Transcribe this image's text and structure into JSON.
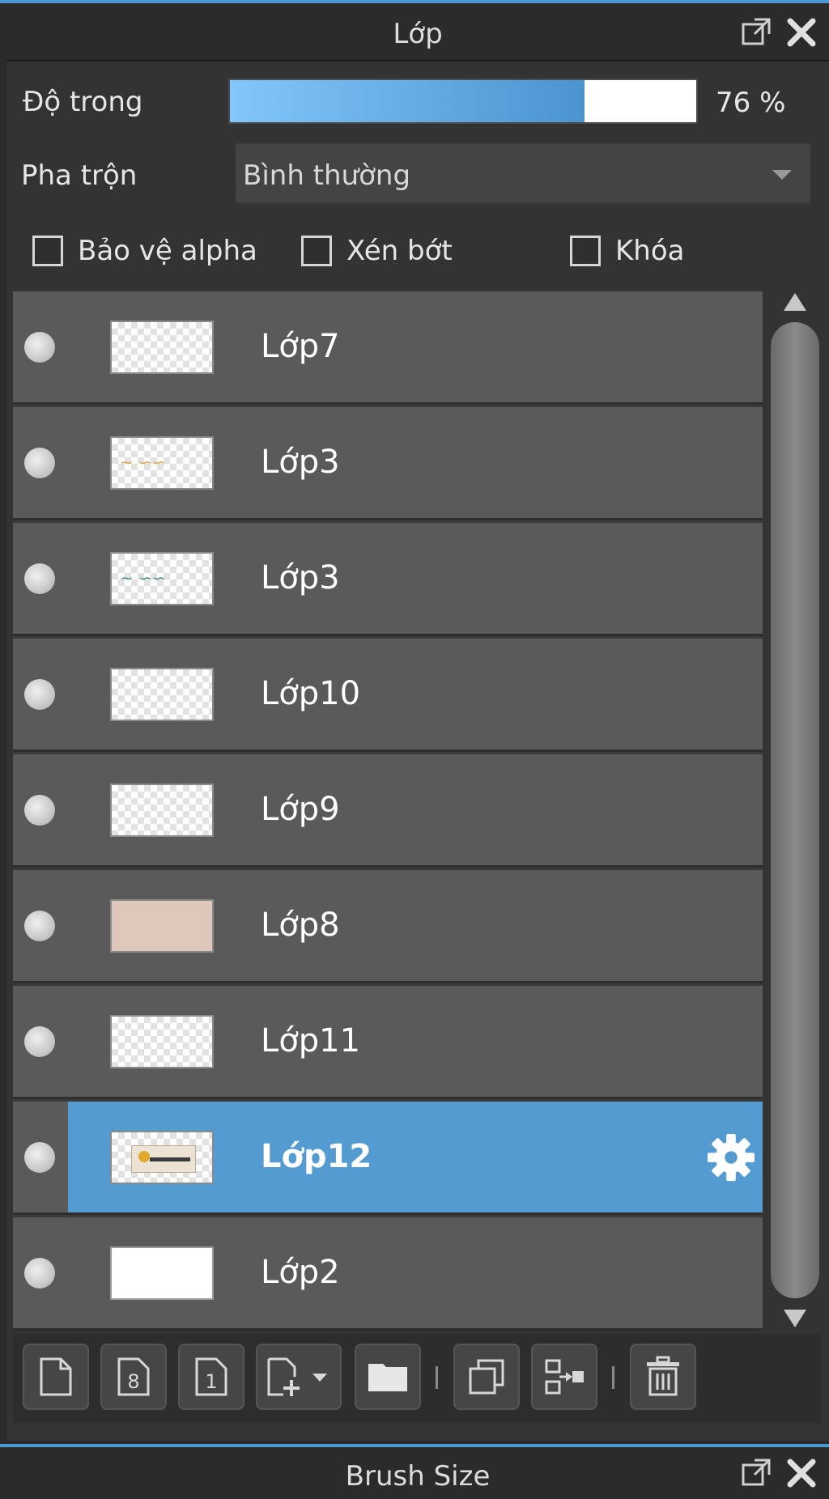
{
  "panel": {
    "title": "Lớp",
    "undock_icon": "undock-icon",
    "close_icon": "close-icon"
  },
  "opacity": {
    "label": "Độ trong",
    "value_text": "76 %",
    "value_percent": 76
  },
  "blend": {
    "label": "Pha trộn",
    "selected": "Bình thường"
  },
  "options": {
    "protect_alpha": {
      "label": "Bảo vệ alpha",
      "checked": false
    },
    "clipping": {
      "label": "Xén bớt",
      "checked": false
    },
    "lock": {
      "label": "Khóa",
      "checked": false
    }
  },
  "layers": [
    {
      "name": "Lớp7",
      "thumb": "transparent"
    },
    {
      "name": "Lớp3",
      "thumb": "transparent-orange-text"
    },
    {
      "name": "Lớp3",
      "thumb": "transparent-teal-text"
    },
    {
      "name": "Lớp10",
      "thumb": "transparent"
    },
    {
      "name": "Lớp9",
      "thumb": "transparent"
    },
    {
      "name": "Lớp8",
      "thumb": "beige"
    },
    {
      "name": "Lớp11",
      "thumb": "transparent"
    },
    {
      "name": "Lớp12",
      "thumb": "scene",
      "selected": true
    },
    {
      "name": "Lớp2",
      "thumb": "white"
    }
  ],
  "toolbar": {
    "buttons": [
      "new-layer-icon",
      "new-8bit-layer-icon",
      "new-1bit-layer-icon",
      "add-layer-dropdown-icon",
      "new-folder-icon",
      "duplicate-layer-icon",
      "merge-down-icon",
      "delete-layer-icon"
    ]
  },
  "colors": {
    "accent": "#4f97cf",
    "selected_row": "#549bd1",
    "row": "#5a5a5a"
  },
  "bottom_panel": {
    "title": "Brush Size"
  }
}
